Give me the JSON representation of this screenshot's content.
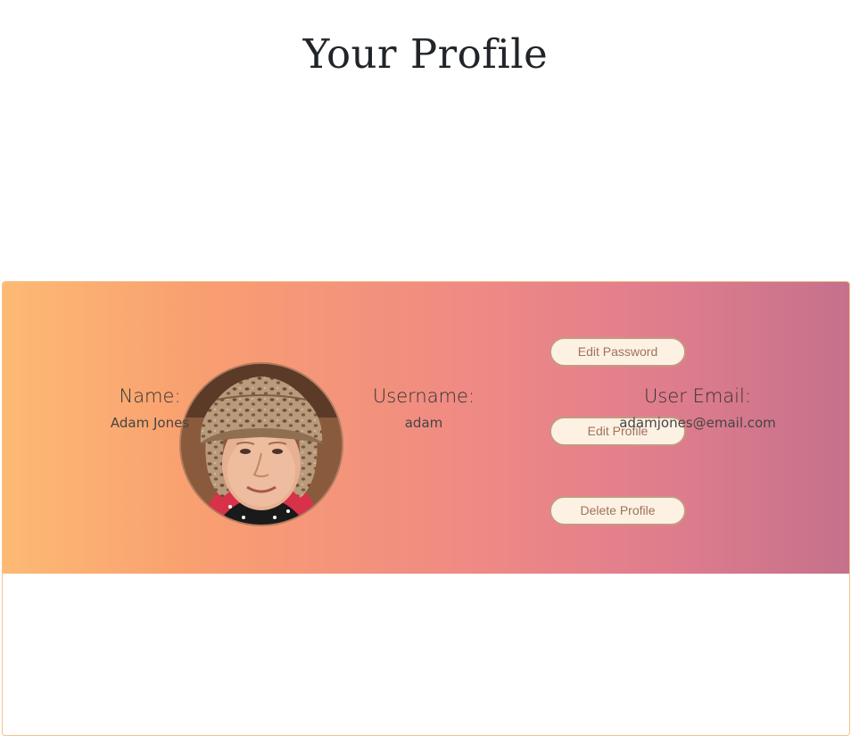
{
  "page": {
    "title": "Your Profile"
  },
  "profile": {
    "avatar_alt": "Profile photo",
    "actions": {
      "edit_password": "Edit Password",
      "edit_profile": "Edit Profile",
      "delete_profile": "Delete Profile"
    },
    "fields": {
      "name_label": "Name:",
      "name_value": "Adam Jones",
      "username_label": "Username:",
      "username_value": "adam",
      "email_label": "User Email:",
      "email_value": "adamjones@email.com"
    }
  },
  "colors": {
    "header_gradient_start": "#fdba74",
    "header_gradient_end": "#c5718c",
    "button_background": "#fdf1e4",
    "button_text": "#a07258",
    "card_border": "#f6c48f"
  }
}
